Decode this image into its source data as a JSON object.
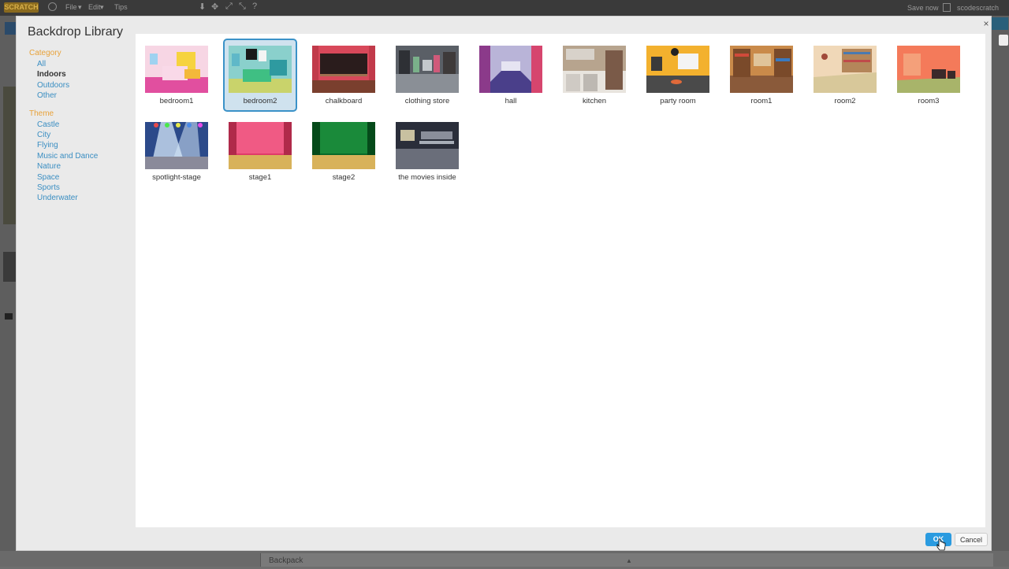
{
  "topbar": {
    "logo": "SCRATCH",
    "menu_file": "File",
    "menu_edit": "Edit",
    "menu_tips": "Tips",
    "save_now": "Save now",
    "username": "scodescratch"
  },
  "bottom": {
    "backpack": "Backpack"
  },
  "modal": {
    "title": "Backdrop Library",
    "close": "×",
    "ok": "OK",
    "cancel": "Cancel"
  },
  "sidebar": {
    "category_heading": "Category",
    "categories": [
      "All",
      "Indoors",
      "Outdoors",
      "Other"
    ],
    "selected_category": "Indoors",
    "theme_heading": "Theme",
    "themes": [
      "Castle",
      "City",
      "Flying",
      "Music and Dance",
      "Nature",
      "Space",
      "Sports",
      "Underwater"
    ]
  },
  "backdrops": [
    {
      "name": "bedroom1",
      "selected": false
    },
    {
      "name": "bedroom2",
      "selected": true
    },
    {
      "name": "chalkboard",
      "selected": false
    },
    {
      "name": "clothing store",
      "selected": false
    },
    {
      "name": "hall",
      "selected": false
    },
    {
      "name": "kitchen",
      "selected": false
    },
    {
      "name": "party room",
      "selected": false
    },
    {
      "name": "room1",
      "selected": false
    },
    {
      "name": "room2",
      "selected": false
    },
    {
      "name": "room3",
      "selected": false
    },
    {
      "name": "spotlight-stage",
      "selected": false
    },
    {
      "name": "stage1",
      "selected": false
    },
    {
      "name": "stage2",
      "selected": false
    },
    {
      "name": "the movies inside",
      "selected": false
    }
  ],
  "colors": {
    "accent": "#2a9be0",
    "link": "#3a8ec2",
    "heading": "#e8a23a",
    "selection_border": "#3b92c8",
    "selection_fill": "#cfe2ee"
  }
}
